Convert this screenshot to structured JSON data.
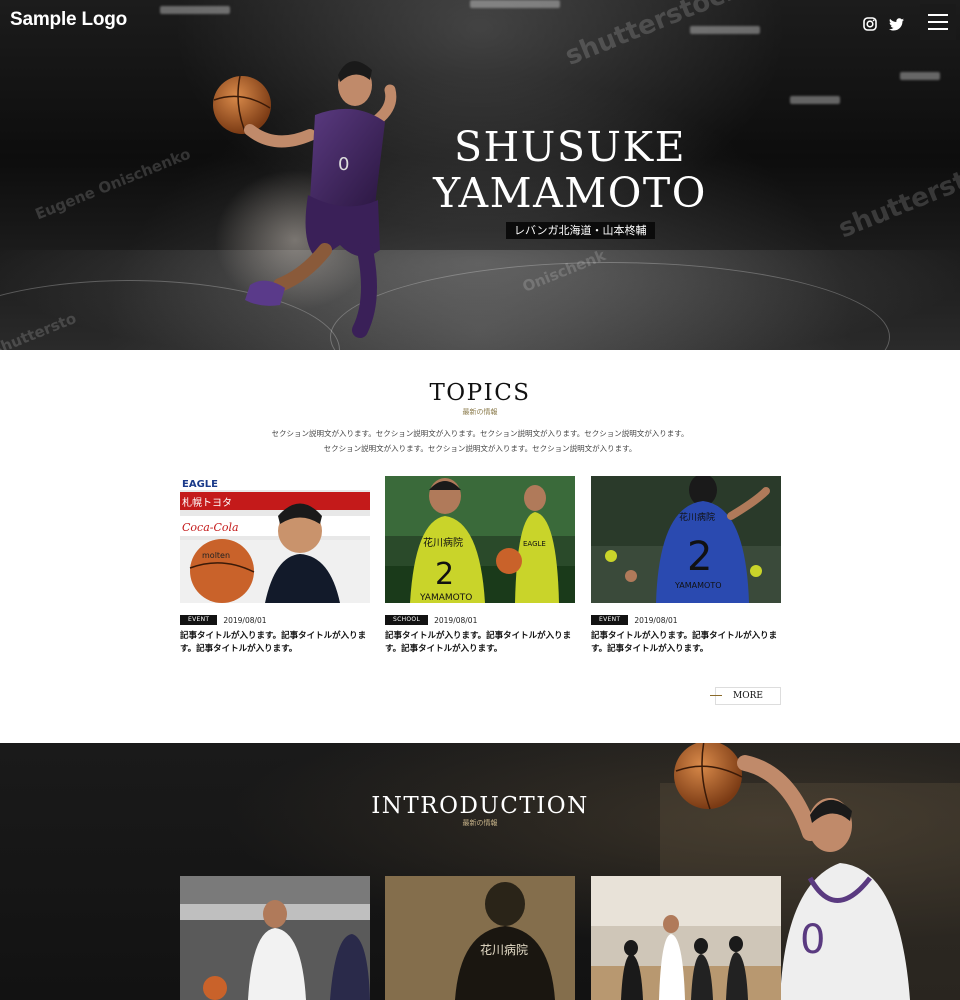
{
  "header": {
    "logo": "Sample Logo",
    "icons": [
      "instagram-icon",
      "twitter-icon",
      "hamburger-menu-icon"
    ]
  },
  "hero": {
    "title_line1": "SHUSUKE",
    "title_line2": "YAMAMOTO",
    "subtitle": "レバンガ北海道・山本柊輔",
    "watermarks": [
      "shutterstock",
      "Eugene Onischenko",
      "shutterst",
      "Onischenk",
      "shuttersto"
    ]
  },
  "topics": {
    "title": "TOPICS",
    "subtitle": "最新の情報",
    "description_line1": "セクション説明文が入ります。セクション説明文が入ります。セクション説明文が入ります。セクション説明文が入ります。",
    "description_line2": "セクション説明文が入ります。セクション説明文が入ります。セクション説明文が入ります。",
    "cards": [
      {
        "tag": "EVENT",
        "date": "2019/08/01",
        "title": "記事タイトルが入ります。記事タイトルが入ります。記事タイトルが入ります。",
        "signs": [
          "EAGLE",
          "札幌トヨタ",
          "Coca-Cola",
          "molten"
        ]
      },
      {
        "tag": "SCHOOL",
        "date": "2019/08/01",
        "title": "記事タイトルが入ります。記事タイトルが入ります。記事タイトルが入ります。",
        "signs": [
          "花川病院",
          "2",
          "YAMAMOTO",
          "EAGLE"
        ]
      },
      {
        "tag": "EVENT",
        "date": "2019/08/01",
        "title": "記事タイトルが入ります。記事タイトルが入ります。記事タイトルが入ります。",
        "signs": [
          "花川病院",
          "2",
          "YAMAMOTO"
        ]
      }
    ],
    "more_label": "MORE"
  },
  "introduction": {
    "title": "INTRODUCTION",
    "subtitle": "最新の情報",
    "signs": [
      "花川病院",
      "0"
    ]
  },
  "colors": {
    "accent_gold": "#8a7a4a",
    "dark": "#121212",
    "player_purple": "#4a2a6a"
  }
}
